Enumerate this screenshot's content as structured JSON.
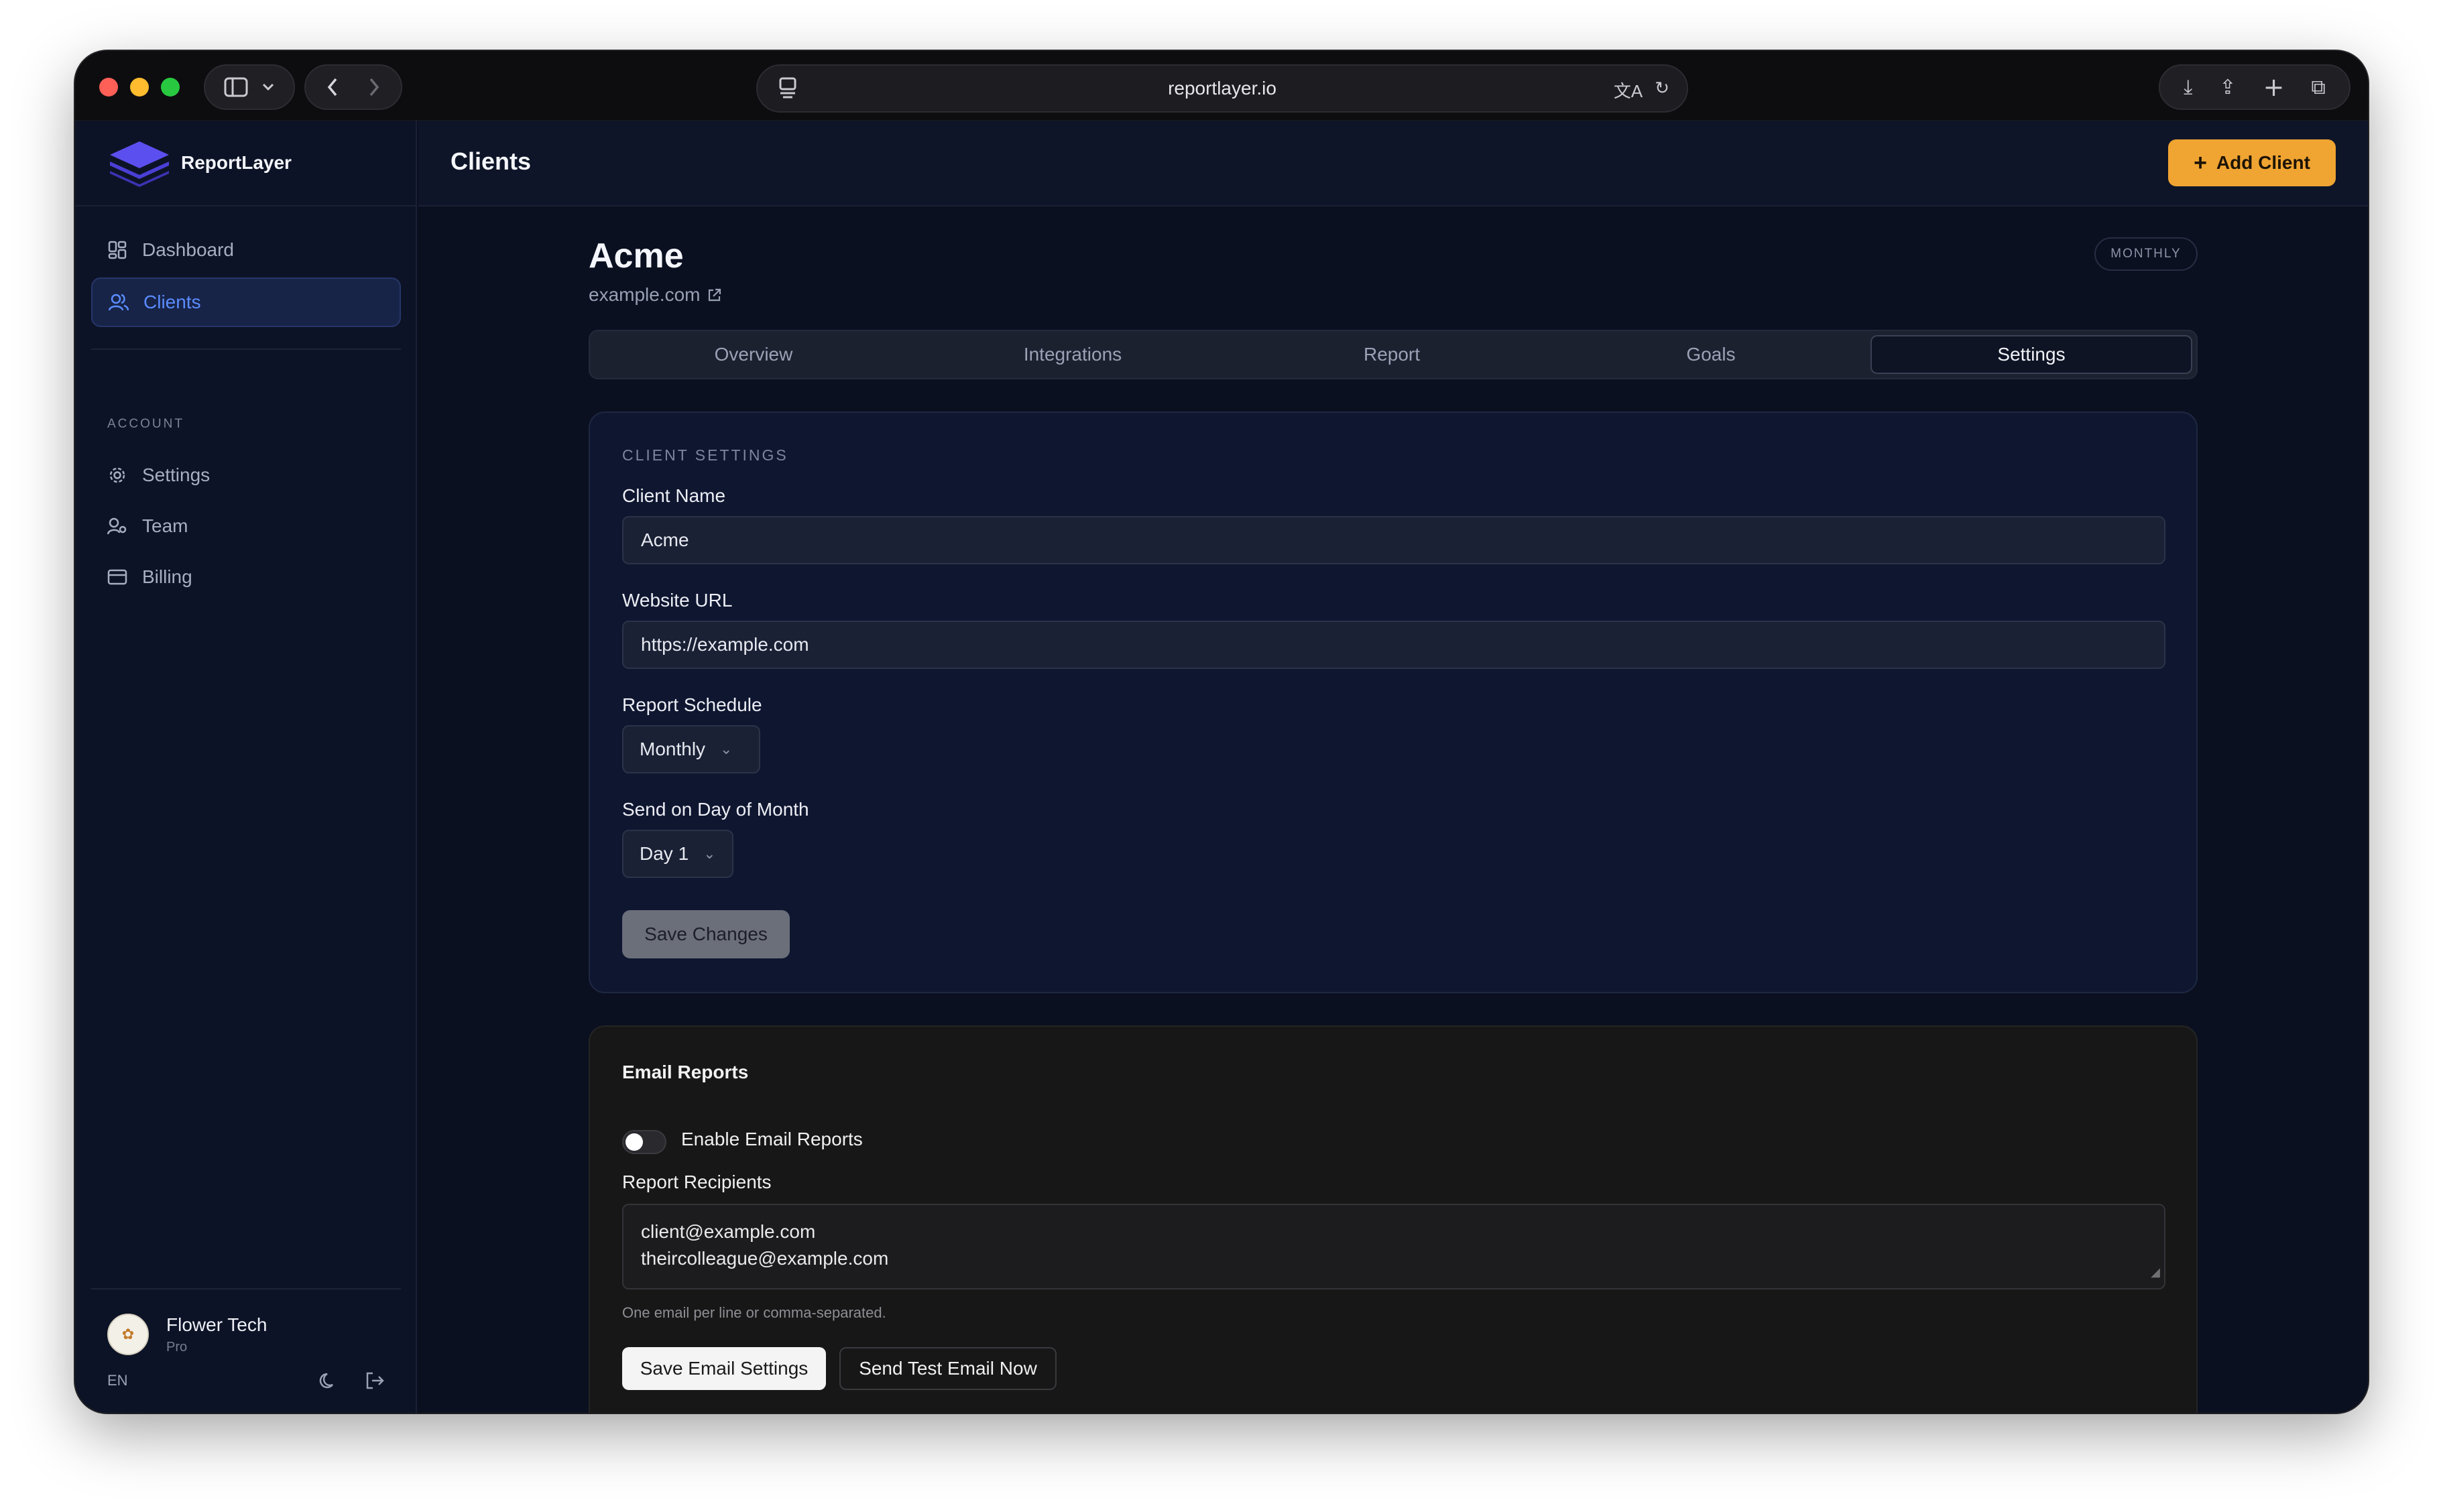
{
  "browser": {
    "url": "reportlayer.io"
  },
  "sidebar": {
    "brand": "ReportLayer",
    "nav": [
      {
        "label": "Dashboard",
        "icon": "dashboard-icon"
      },
      {
        "label": "Clients",
        "icon": "users-icon"
      }
    ],
    "section_label": "ACCOUNT",
    "account": [
      {
        "label": "Settings",
        "icon": "gear-icon"
      },
      {
        "label": "Team",
        "icon": "team-icon"
      },
      {
        "label": "Billing",
        "icon": "card-icon"
      }
    ],
    "user": {
      "name": "Flower Tech",
      "plan": "Pro"
    },
    "language": "EN"
  },
  "header": {
    "title": "Clients",
    "add_button": "Add Client",
    "accent_color": "#f0a432"
  },
  "client": {
    "name": "Acme",
    "domain": "example.com",
    "badge": "MONTHLY"
  },
  "tabs": [
    "Overview",
    "Integrations",
    "Report",
    "Goals",
    "Settings"
  ],
  "active_tab": "Settings",
  "settings": {
    "section_title": "CLIENT SETTINGS",
    "client_name_label": "Client Name",
    "client_name_value": "Acme",
    "website_label": "Website URL",
    "website_value": "https://example.com",
    "schedule_label": "Report Schedule",
    "schedule_value": "Monthly",
    "day_label": "Send on Day of Month",
    "day_value": "Day 1",
    "save_button": "Save Changes"
  },
  "email": {
    "title": "Email Reports",
    "toggle_label": "Enable Email Reports",
    "toggle_on": false,
    "recipients_label": "Report Recipients",
    "recipients": [
      "client@example.com",
      "theircolleague@example.com"
    ],
    "help": "One email per line or comma-separated.",
    "save_button": "Save Email Settings",
    "test_button": "Send Test Email Now"
  }
}
